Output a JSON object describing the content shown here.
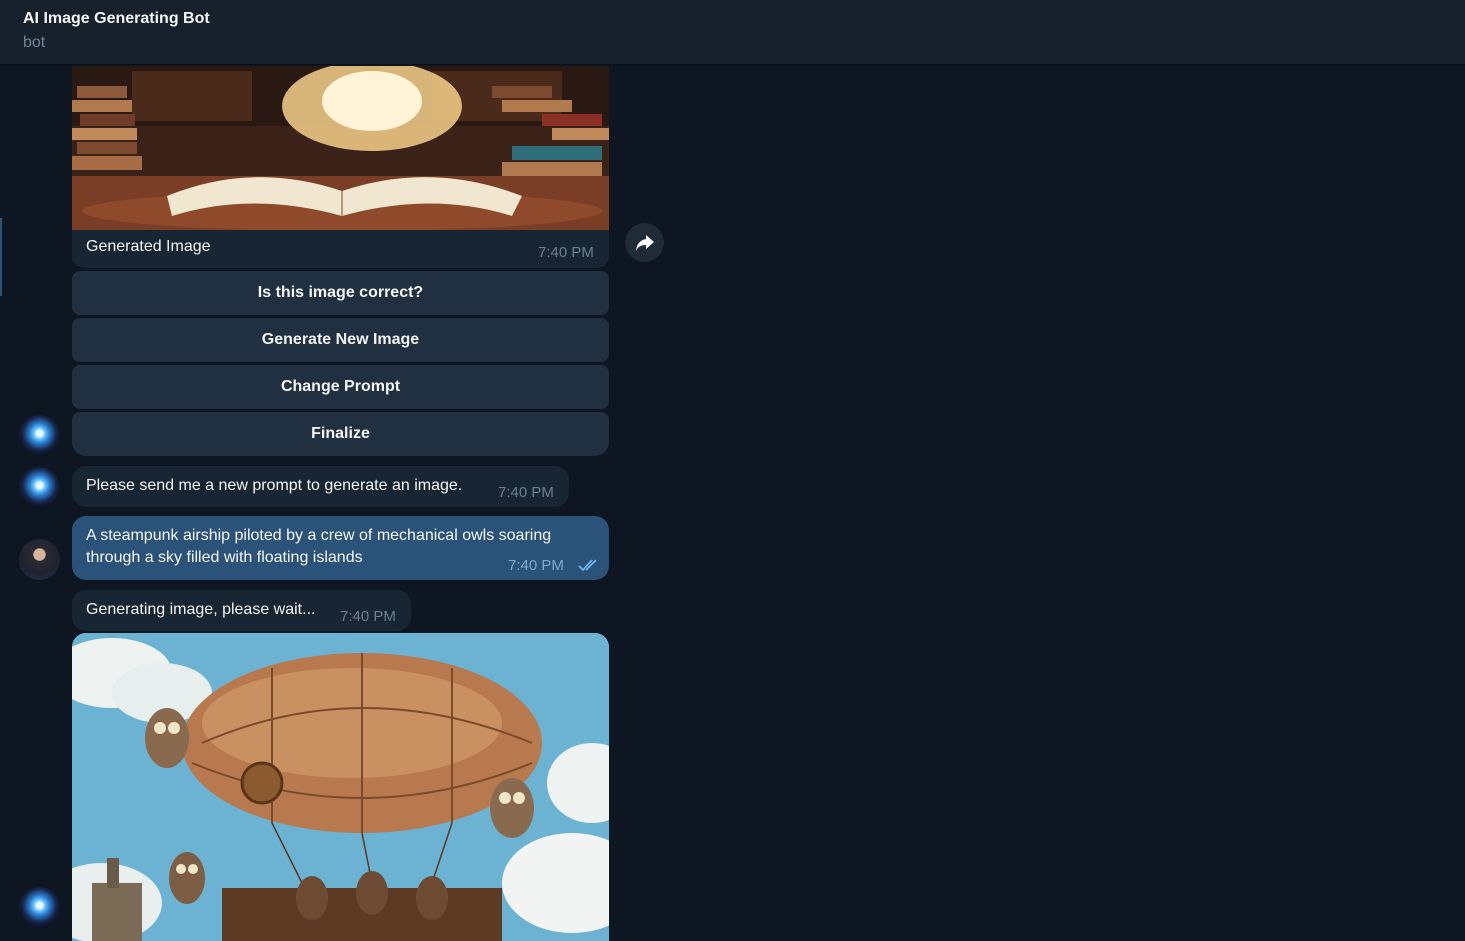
{
  "header": {
    "title": "AI Image Generating Bot",
    "subtitle": "bot"
  },
  "messages": {
    "generated": {
      "caption": "Generated Image",
      "time": "7:40 PM"
    },
    "keyboard": [
      "Is this image correct?",
      "Generate New Image",
      "Change Prompt",
      "Finalize"
    ],
    "bot_prompt_request": {
      "text": "Please send me a new prompt to generate an image.",
      "time": "7:40 PM"
    },
    "user_prompt": {
      "line1": "A steampunk airship piloted by a crew of mechanical owls soaring",
      "line2": "through a sky filled with floating islands",
      "time": "7:40 PM",
      "status": "read"
    },
    "generating": {
      "text": "Generating image, please wait...",
      "time": "7:40 PM"
    }
  },
  "icons": {
    "forward": "forward-arrow-icon",
    "read_receipt": "double-check-icon"
  },
  "colors": {
    "background": "#0e1621",
    "incoming_bubble": "#182533",
    "outgoing_bubble": "#2b5278",
    "keyboard_button": "#213040",
    "accent": "#4fa3e3"
  }
}
